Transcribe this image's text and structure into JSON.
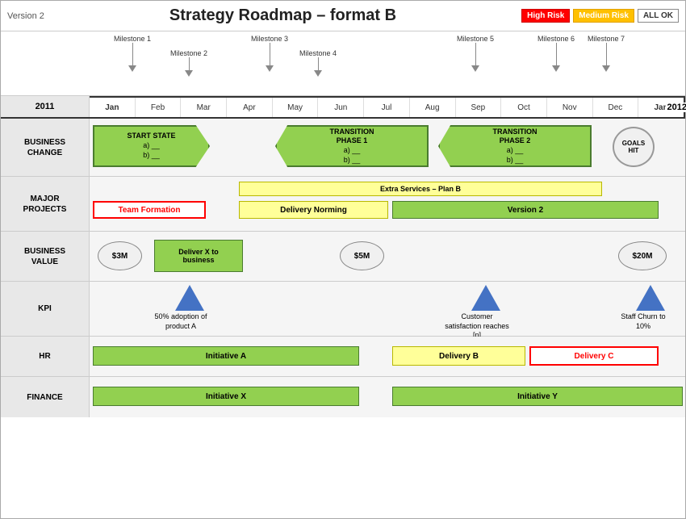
{
  "header": {
    "version": "Version 2",
    "title": "Strategy Roadmap – format B",
    "legend": {
      "high_risk": "High Risk",
      "medium_risk": "Medium Risk",
      "all_ok": "ALL OK"
    }
  },
  "milestones": [
    {
      "label": "Milestone 1",
      "col": 0.5
    },
    {
      "label": "Milestone 2",
      "col": 1.5
    },
    {
      "label": "Milestone 3",
      "col": 3.2
    },
    {
      "label": "Milestone 4",
      "col": 4.2
    },
    {
      "label": "Milestone 5",
      "col": 7.5
    },
    {
      "label": "Milestone 6",
      "col": 9.0
    },
    {
      "label": "Milestone 7",
      "col": 10.0
    }
  ],
  "months": [
    "Jan",
    "Feb",
    "Mar",
    "Apr",
    "May",
    "Jun",
    "Jul",
    "Aug",
    "Sep",
    "Oct",
    "Nov",
    "Dec",
    "Jan"
  ],
  "years": {
    "left": "2011",
    "right": "2012"
  },
  "rows": {
    "business_change": {
      "label": "BUSINESS CHANGE",
      "start_state": "START STATE\na)\nb)",
      "transition1": "TRANSITION\nPHASE 1\na)\nb)",
      "transition2": "TRANSITION\nPHASE 2\na)\nb)",
      "goals": "GOALS\nHIT"
    },
    "major_projects": {
      "label": "MAJOR PROJECTS",
      "extra_services": "Extra Services – Plan B",
      "team_formation": "Team Formation",
      "delivery_norming": "Delivery Norming",
      "version2": "Version 2"
    },
    "business_value": {
      "label": "BUSINESS VALUE",
      "s3m": "$3M",
      "deliver_x": "Deliver X to\nbusiness",
      "s5m": "$5M",
      "s20m": "$20M"
    },
    "kpi": {
      "label": "KPI",
      "kpi1_text": "50%\nadoption of\nproduct A",
      "kpi2_text": "Customer\nsatisfaction\nreaches [n]",
      "kpi3_text": "Staff Churn\nto 10%"
    },
    "hr": {
      "label": "HR",
      "initiative_a": "Initiative A",
      "delivery_b": "Delivery B",
      "delivery_c": "Delivery C"
    },
    "finance": {
      "label": "FINANCE",
      "initiative_x": "Initiative X",
      "initiative_y": "Initiative Y"
    }
  }
}
